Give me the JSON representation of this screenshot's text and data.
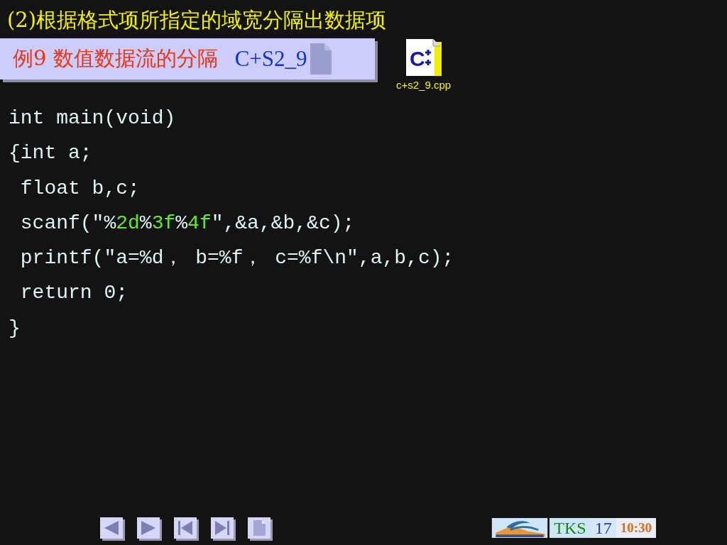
{
  "heading": "(2)根据格式项所指定的域宽分隔出数据项",
  "example_banner": {
    "title": "例9 数值数据流的分隔",
    "code": "C+S2_9"
  },
  "file_icon": {
    "letter": "C",
    "label": "c+s2_9.cpp"
  },
  "code_lines": [
    {
      "segments": [
        {
          "kind": "plain",
          "text": "int main(void)"
        }
      ]
    },
    {
      "segments": [
        {
          "kind": "plain",
          "text": "{int a;"
        }
      ]
    },
    {
      "segments": [
        {
          "kind": "plain",
          "text": " float b,c;"
        }
      ]
    },
    {
      "segments": [
        {
          "kind": "plain",
          "text": " scanf(″%"
        },
        {
          "kind": "highlight",
          "text": "2d"
        },
        {
          "kind": "plain",
          "text": "%"
        },
        {
          "kind": "highlight",
          "text": "3f"
        },
        {
          "kind": "plain",
          "text": "%"
        },
        {
          "kind": "highlight",
          "text": "4f"
        },
        {
          "kind": "plain",
          "text": "″,&a,&b,&c);"
        }
      ]
    },
    {
      "segments": [
        {
          "kind": "plain",
          "text": " printf(″a=%d， b=%f， c=%f\\n″,a,b,c);"
        }
      ]
    },
    {
      "segments": [
        {
          "kind": "plain",
          "text": " return 0;"
        }
      ]
    },
    {
      "segments": [
        {
          "kind": "plain",
          "text": "}"
        }
      ]
    }
  ],
  "nav_buttons": [
    {
      "kind": "previous"
    },
    {
      "kind": "next"
    },
    {
      "kind": "first"
    },
    {
      "kind": "last"
    },
    {
      "kind": "page"
    }
  ],
  "footer": {
    "label": "TKS",
    "page": "17",
    "time": "10:30"
  }
}
